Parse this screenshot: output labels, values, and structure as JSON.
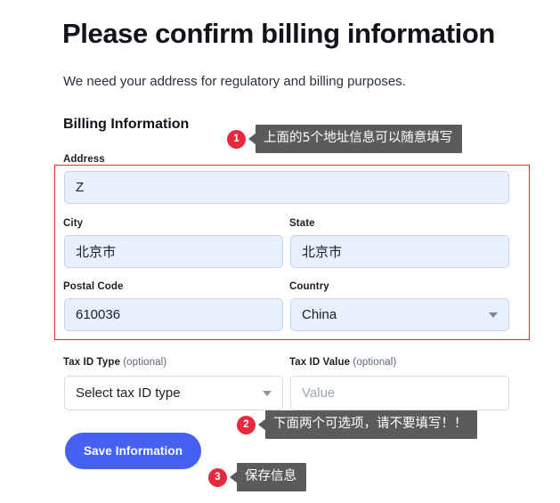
{
  "page": {
    "title": "Please confirm billing information",
    "subtitle": "We need your address for regulatory and billing purposes.",
    "section_title": "Billing Information"
  },
  "colors": {
    "accent_button": "#4461f2",
    "highlight_border": "#ef2b25",
    "badge": "#e8283c",
    "tooltip_bg": "#5b5b5b",
    "autofill_field_bg": "#e8f0fe"
  },
  "form": {
    "address": {
      "label": "Address",
      "value": "Z",
      "placeholder": ""
    },
    "city": {
      "label": "City",
      "value": "北京市",
      "placeholder": ""
    },
    "state": {
      "label": "State",
      "value": "北京市",
      "placeholder": ""
    },
    "postal_code": {
      "label": "Postal Code",
      "value": "610036",
      "placeholder": ""
    },
    "country": {
      "label": "Country",
      "value": "China",
      "caret_icon": "chevron-down-icon"
    },
    "tax_id_type": {
      "label_strong": "Tax ID Type",
      "label_optional": " (optional)",
      "value": "Select tax ID type",
      "caret_icon": "chevron-down-icon"
    },
    "tax_id_value": {
      "label_strong": "Tax ID Value",
      "label_optional": " (optional)",
      "value": "",
      "placeholder": "Value"
    }
  },
  "actions": {
    "save_label": "Save Information"
  },
  "annotations": [
    {
      "number": "1",
      "text": "上面的5个地址信息可以随意填写"
    },
    {
      "number": "2",
      "text": "下面两个可选项，请不要填写！！"
    },
    {
      "number": "3",
      "text": "保存信息"
    }
  ]
}
